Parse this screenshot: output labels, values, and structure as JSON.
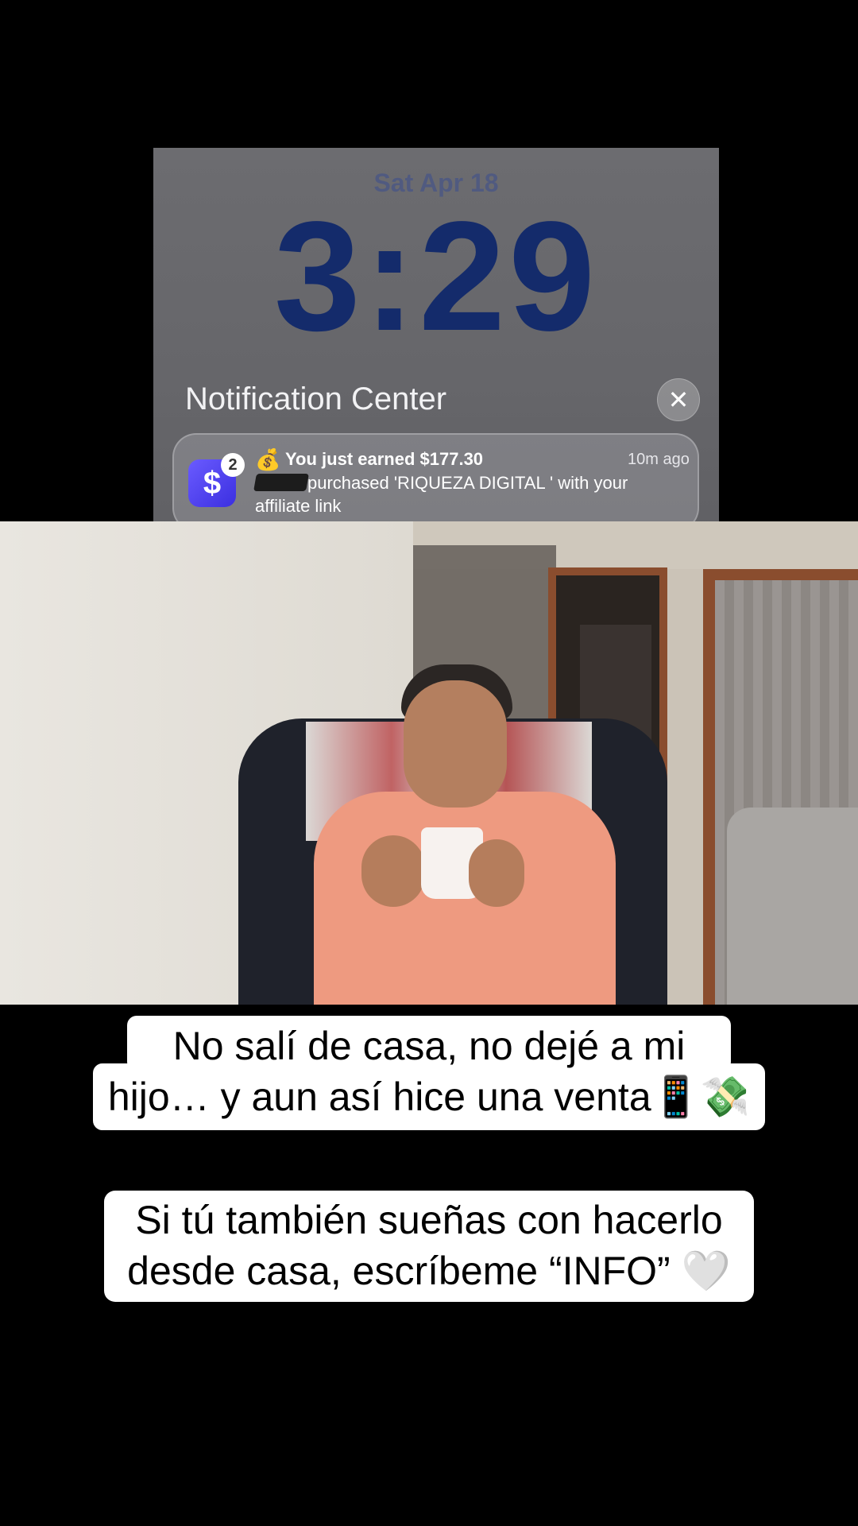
{
  "lock_screen": {
    "date": "Sat Apr 18",
    "time": "3:29",
    "notification_center_title": "Notification Center",
    "close_icon": "close-icon",
    "notification": {
      "app_icon": "cash-app-icon",
      "app_glyph": "$",
      "badge_count": "2",
      "emoji": "💰",
      "title": "You just earned $177.30",
      "time": "10m ago",
      "body": "purchased 'RIQUEZA DIGITAL ' with your affiliate link"
    }
  },
  "captions": {
    "line1": "No salí de casa, no dejé a mi",
    "line2": "hijo… y aun así hice una venta📱💸",
    "line3": "Si tú también sueñas con hacerlo",
    "line4": "desde casa, escríbeme “INFO” 🤍"
  },
  "colors": {
    "background": "#000000",
    "clock": "#142b6b",
    "app_icon": "#5a4cff",
    "caption_bg": "#ffffff"
  }
}
